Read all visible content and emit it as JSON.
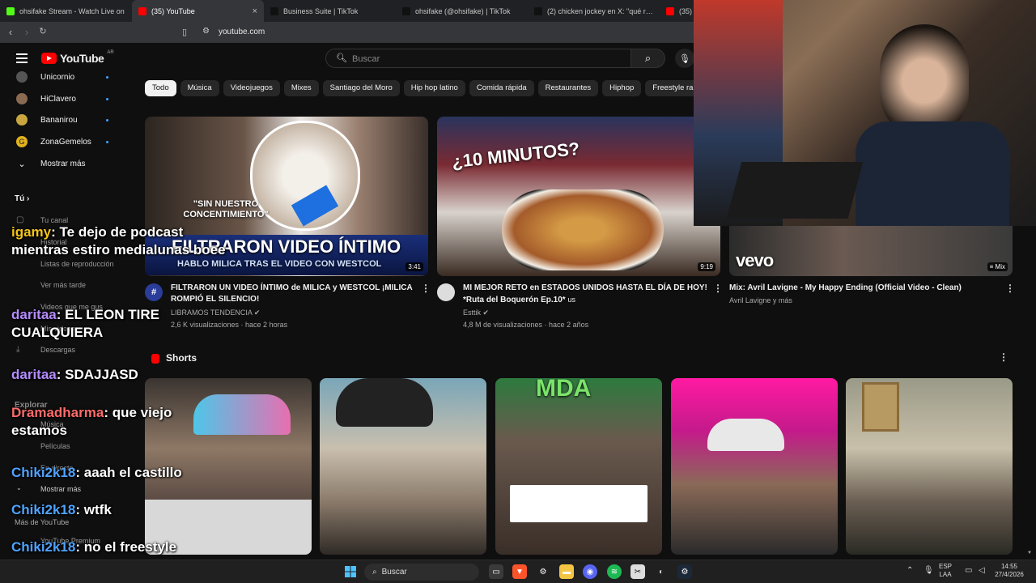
{
  "browser": {
    "tabs": [
      {
        "title": "ohsifake Stream - Watch Live on",
        "color": "#53fc18",
        "active": false
      },
      {
        "title": "(35) YouTube",
        "color": "#ff0000",
        "active": true
      },
      {
        "title": "Business Suite | TikTok",
        "color": "#111111",
        "active": false
      },
      {
        "title": "ohsifake (@ohsifake) | TikTok",
        "color": "#111111",
        "active": false
      },
      {
        "title": "(2) chicken jockey en X: \"qué raro el",
        "color": "#111111",
        "active": false
      },
      {
        "title": "(35) Y",
        "color": "#ff0000",
        "active": false
      }
    ],
    "url": "youtube.com"
  },
  "header": {
    "logo_text": "YouTube",
    "country_code": "AR",
    "search_placeholder": "Buscar"
  },
  "sidebar": {
    "subscriptions": [
      {
        "label": "Unicornio",
        "color": "#6b6b6b"
      },
      {
        "label": "HiClavero",
        "color": "#8b6a52"
      },
      {
        "label": "Bananirou",
        "color": "#c9a640"
      },
      {
        "label": "ZonaGemelos",
        "color": "#e1b21d"
      }
    ],
    "show_more": "Mostrar más",
    "you_section": "Tú",
    "you_items": [
      "Tu canal",
      "Historial",
      "Listas de reproducción",
      "Ver más tarde",
      "Videos que me gus",
      "Mis videos",
      "Descargas"
    ],
    "explore_section": "Explorar",
    "explore_items": [
      "Música",
      "Películas",
      "En directo"
    ],
    "show_more_2": "Mostrar más",
    "more_section": "Más de YouTube",
    "premium": "YouTube Premium"
  },
  "chips": [
    "Todo",
    "Música",
    "Videojuegos",
    "Mixes",
    "Santiago del Moro",
    "Hip hop latino",
    "Comida rápida",
    "Restaurantes",
    "Hiphop",
    "Freestyle ra"
  ],
  "videos": [
    {
      "title": "FILTRARON UN VIDEO ÍNTIMO de MILICA y WESTCOL ¡MILICA ROMPIÓ EL SILENCIO!",
      "channel": "LIBRAMOS TENDENCIA",
      "meta": "2,6 K visualizaciones · hace 2 horas",
      "duration": "3:41",
      "thumb_text_1": "\"SIN NUESTRO CONCENTIMIENTO\"",
      "thumb_text_2": "FILTRARON VIDEO ÍNTIMO",
      "thumb_text_3": "HABLO MILICA TRAS EL VIDEO CON WESTCOL"
    },
    {
      "title": "MI MEJOR RETO en ESTADOS UNIDOS HASTA EL DÍA DE HOY! *Ruta del Boquerón Ep.10*",
      "title_suffix": "us",
      "channel": "Esttik",
      "meta": "4,8 M de visualizaciones · hace 2 años",
      "duration": "9:19",
      "thumb_text_1": "¿10 MINUTOS?"
    },
    {
      "title": "Mix: Avril Lavigne - My Happy Ending (Official Video - Clean)",
      "channel": "Avril Lavigne y más",
      "badge": "Mix",
      "thumb_text_1": "vevo"
    }
  ],
  "shorts": {
    "title": "Shorts",
    "items": [
      "",
      "",
      "MDA",
      "",
      ""
    ]
  },
  "chat": [
    {
      "user": "igamy",
      "message": "Te dejo de podcast mientras estiro medialunas boee",
      "color": "#f5c518"
    },
    {
      "user": "daritaa",
      "message": "EL LEON TIRE CUALQUIERA",
      "color": "#b58cff"
    },
    {
      "user": "daritaa",
      "message": "SDAJJASD",
      "color": "#b58cff"
    },
    {
      "user": "Dramadharma",
      "message": "que viejo estamos",
      "color": "#ff6b6b"
    },
    {
      "user": "Chiki2k18",
      "message": "aaah el castillo",
      "color": "#4fa3ff"
    },
    {
      "user": "Chiki2k18",
      "message": "wtfk",
      "color": "#4fa3ff"
    },
    {
      "user": "Chiki2k18",
      "message": "no el freestyle",
      "color": "#4fa3ff"
    }
  ],
  "taskbar": {
    "search_label": "Buscar",
    "lang_top": "ESP",
    "lang_bottom": "LAA",
    "time": "14:55",
    "date": "27/4/2026"
  }
}
